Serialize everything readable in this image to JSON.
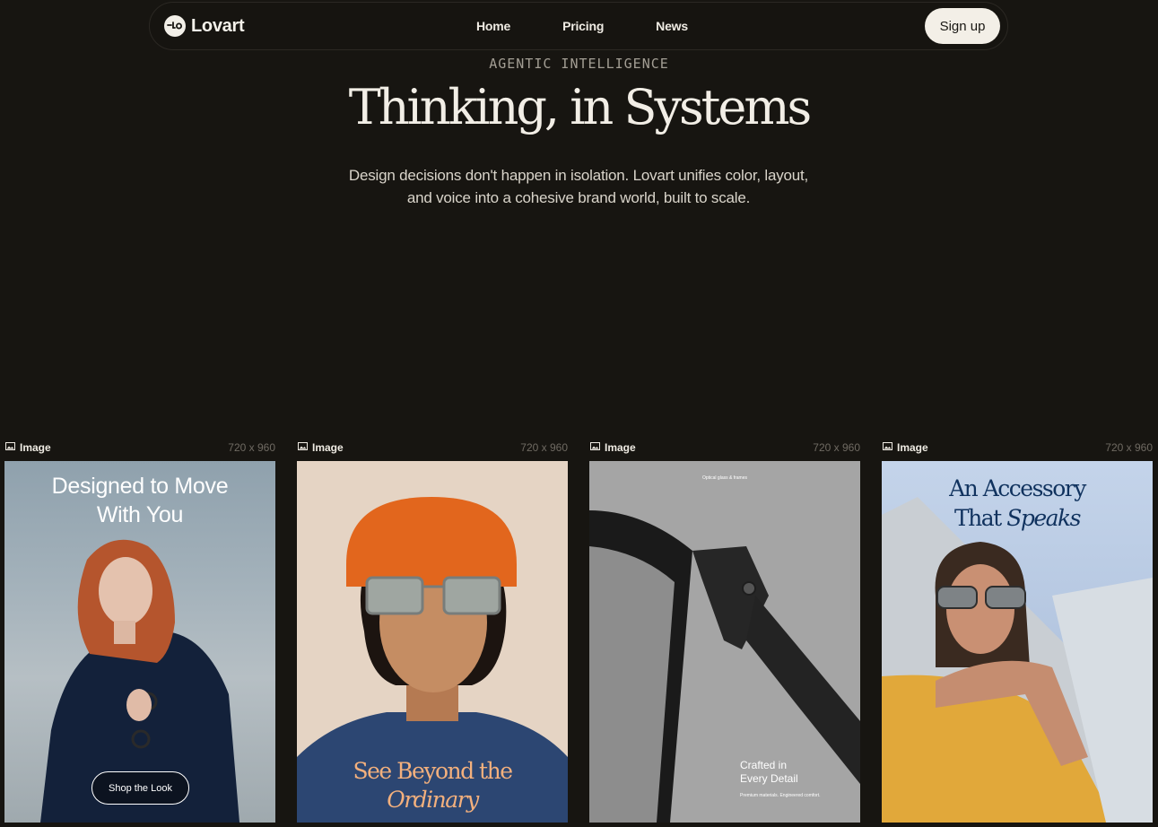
{
  "nav": {
    "brand": "Lovart",
    "links": [
      "Home",
      "Pricing",
      "News"
    ],
    "signup_label": "Sign up"
  },
  "hero": {
    "eyebrow": "AGENTIC INTELLIGENCE",
    "headline": "Thinking, in Systems",
    "subtext": "Design decisions don't happen in isolation. Lovart unifies color, layout, and voice into a cohesive brand world, built to scale."
  },
  "cards": [
    {
      "type_label": "Image",
      "dims": "720 x 960",
      "title_line1": "Designed to Move",
      "title_line2": "With You",
      "button_label": "Shop the Look"
    },
    {
      "type_label": "Image",
      "dims": "720 x 960",
      "title_line1": "See Beyond the",
      "title_line2": "Ordinary"
    },
    {
      "type_label": "Image",
      "dims": "720 x 960",
      "tiny_top": "Optical glass & frames",
      "title_line1": "Crafted in",
      "title_line2": "Every Detail",
      "tiny_bottom": "Premium materials. Engineered comfort."
    },
    {
      "type_label": "Image",
      "dims": "720 x 960",
      "title_line1": "An Accessory",
      "title_line2_a": "That ",
      "title_line2_b": "Speaks"
    }
  ],
  "colors": {
    "background": "#171511",
    "button_light": "#f3efe7",
    "card2_accent": "#f3b07d",
    "card4_accent": "#10325e"
  }
}
